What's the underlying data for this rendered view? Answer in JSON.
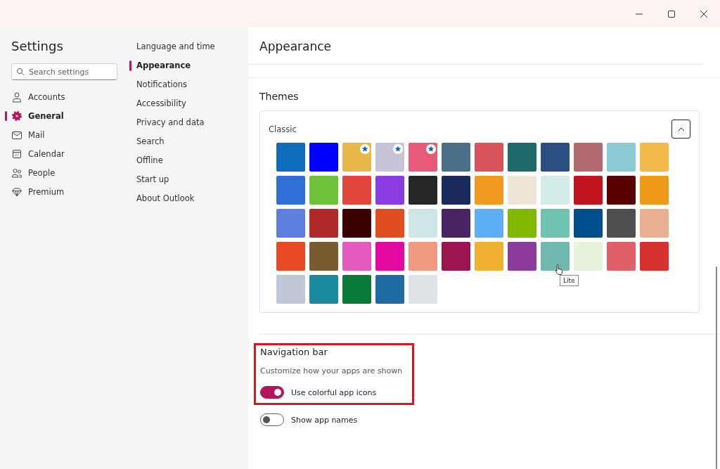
{
  "sidebar": {
    "title": "Settings",
    "search": {
      "placeholder": "Search settings"
    },
    "items": [
      {
        "label": "Accounts",
        "kind": "person",
        "selected": false
      },
      {
        "label": "General",
        "kind": "gear",
        "selected": true
      },
      {
        "label": "Mail",
        "kind": "mail",
        "selected": false
      },
      {
        "label": "Calendar",
        "kind": "calendar",
        "selected": false
      },
      {
        "label": "People",
        "kind": "people",
        "selected": false
      },
      {
        "label": "Premium",
        "kind": "diamond",
        "selected": false
      }
    ]
  },
  "subnav": {
    "items": [
      {
        "label": "Language and time",
        "selected": false
      },
      {
        "label": "Appearance",
        "selected": true
      },
      {
        "label": "Notifications",
        "selected": false
      },
      {
        "label": "Accessibility",
        "selected": false
      },
      {
        "label": "Privacy and data",
        "selected": false
      },
      {
        "label": "Search",
        "selected": false
      },
      {
        "label": "Offline",
        "selected": false
      },
      {
        "label": "Start up",
        "selected": false
      },
      {
        "label": "About Outlook",
        "selected": false
      }
    ]
  },
  "content": {
    "title": "Appearance",
    "themes": {
      "heading": "Themes",
      "group": "Classic",
      "expanded": true,
      "tooltip": "Lite",
      "tiles": [
        {
          "color": "#0f6cbd",
          "starred": false
        },
        {
          "color": "#0000ff",
          "starred": false
        },
        {
          "color": "#e8b84a",
          "starred": true
        },
        {
          "color": "#c9c3d8",
          "starred": true
        },
        {
          "color": "#e85a7a",
          "starred": true
        },
        {
          "color": "#4a6f86",
          "starred": false
        },
        {
          "color": "#d9535a",
          "starred": false
        },
        {
          "color": "#1f6b6b",
          "starred": false
        },
        {
          "color": "#2a4f80",
          "starred": false
        },
        {
          "color": "#b06a70",
          "starred": false
        },
        {
          "color": "#8ec9d6",
          "starred": false
        },
        {
          "color": "#f5b94a",
          "starred": false
        },
        {
          "color": "#2f6fd6",
          "starred": false
        },
        {
          "color": "#6ec23a",
          "starred": false
        },
        {
          "color": "#e0463c",
          "starred": false
        },
        {
          "color": "#8a3ce0",
          "starred": false
        },
        {
          "color": "#262626",
          "starred": false
        },
        {
          "color": "#1b2a5c",
          "starred": false
        },
        {
          "color": "#f29a1f",
          "starred": false
        },
        {
          "color": "#f0e6d8",
          "starred": false
        },
        {
          "color": "#d4ece8",
          "starred": false
        },
        {
          "color": "#c2141f",
          "starred": false
        },
        {
          "color": "#5a0000",
          "starred": false
        },
        {
          "color": "#f09a1c",
          "starred": false
        },
        {
          "color": "#5f7fe0",
          "starred": false
        },
        {
          "color": "#b02a2a",
          "starred": false
        },
        {
          "color": "#3a0000",
          "starred": false
        },
        {
          "color": "#e04e20",
          "starred": false
        },
        {
          "color": "#cfe6e6",
          "starred": false
        },
        {
          "color": "#4a2362",
          "starred": false
        },
        {
          "color": "#5caff5",
          "starred": false
        },
        {
          "color": "#7fba00",
          "starred": false
        },
        {
          "color": "#6fc3b0",
          "starred": false
        },
        {
          "color": "#004e8c",
          "starred": false
        },
        {
          "color": "#4f4f4f",
          "starred": false
        },
        {
          "color": "#e8b090",
          "starred": false
        },
        {
          "color": "#e84a25",
          "starred": false
        },
        {
          "color": "#7a5a30",
          "starred": false
        },
        {
          "color": "#e35bbf",
          "starred": false
        },
        {
          "color": "#e3089f",
          "starred": false
        },
        {
          "color": "#ef9a80",
          "starred": false
        },
        {
          "color": "#9b1650",
          "starred": false
        },
        {
          "color": "#f0b030",
          "starred": false
        },
        {
          "color": "#8d3b9b",
          "starred": false
        },
        {
          "color": "#6fb8b0",
          "starred": false
        },
        {
          "color": "#e6f4dc",
          "starred": false
        },
        {
          "color": "#e0606a",
          "starred": false
        },
        {
          "color": "#d93030",
          "starred": false
        },
        {
          "color": "#c0c8d8",
          "starred": false
        },
        {
          "color": "#1a8b9e",
          "starred": false
        },
        {
          "color": "#0a7a3a",
          "starred": false
        },
        {
          "color": "#1f6aa0",
          "starred": false
        },
        {
          "color": "#dfe3e8",
          "starred": false
        }
      ]
    },
    "navigation_bar": {
      "heading": "Navigation bar",
      "description": "Customize how your apps are shown",
      "toggles": [
        {
          "label": "Use colorful app icons",
          "on": true
        },
        {
          "label": "Show app names",
          "on": false
        }
      ]
    }
  }
}
